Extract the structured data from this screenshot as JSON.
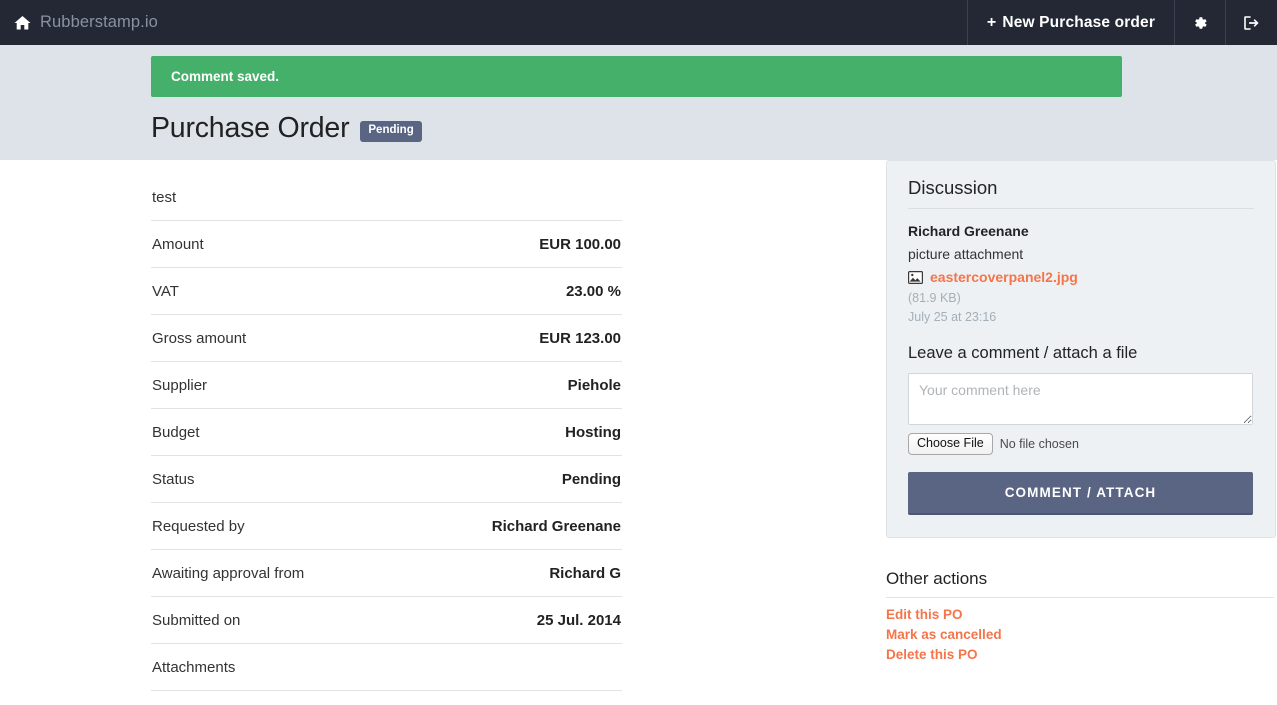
{
  "navbar": {
    "brand": "Rubberstamp.io",
    "home_icon": "home-icon",
    "new_po_label": "New Purchase order",
    "plus": "+",
    "settings_icon": "gear-icon",
    "signout_icon": "sign-out-icon",
    "background": "#232834"
  },
  "header": {
    "alert": "Comment saved.",
    "alert_color": "#45b06a",
    "title": "Purchase Order",
    "badge": "Pending",
    "badge_color": "#5a6483",
    "background": "#dde3e9"
  },
  "details": {
    "description": "test",
    "rows": [
      {
        "label": "Amount",
        "value": "EUR 100.00"
      },
      {
        "label": "VAT",
        "value": "23.00 %"
      },
      {
        "label": "Gross amount",
        "value": "EUR 123.00"
      },
      {
        "label": "Supplier",
        "value": "Piehole"
      },
      {
        "label": "Budget",
        "value": "Hosting"
      },
      {
        "label": "Status",
        "value": "Pending"
      },
      {
        "label": "Requested by",
        "value": "Richard Greenane"
      },
      {
        "label": "Awaiting approval from",
        "value": "Richard G"
      },
      {
        "label": "Submitted on",
        "value": "25 Jul. 2014"
      }
    ],
    "attachments_label": "Attachments"
  },
  "discussion": {
    "title": "Discussion",
    "comment": {
      "author": "Richard Greenane",
      "text": "picture attachment",
      "attachment_icon": "picture-icon",
      "attachment_name": "eastercoverpanel2.jpg",
      "attachment_size": "(81.9 KB)",
      "timestamp": "July 25 at 23:16",
      "link_color": "#f4754a"
    },
    "form": {
      "title": "Leave a comment / attach a file",
      "comment_placeholder": "Your comment here",
      "comment_value": "",
      "file_button": "Choose File",
      "file_status": "No file chosen",
      "submit_label": "COMMENT / ATTACH"
    }
  },
  "other_actions": {
    "title": "Other actions",
    "links": [
      "Edit this PO",
      "Mark as cancelled",
      "Delete this PO"
    ]
  }
}
